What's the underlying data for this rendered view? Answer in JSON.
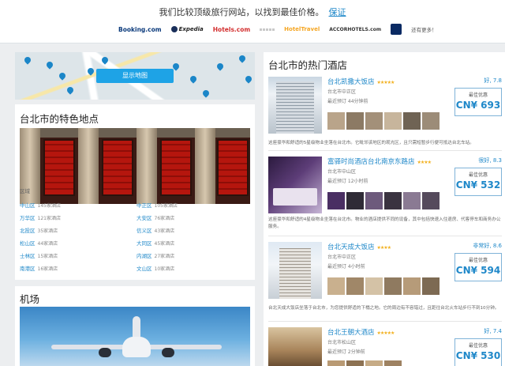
{
  "header": {
    "headline": "我们比较顶级旅行网站，以找到最佳价格。",
    "guarantee_link": "保证",
    "partners": {
      "booking": "Booking.com",
      "expedia": "Expedia",
      "hotels": "Hotels.com",
      "hoteltravel": "HotelTravel",
      "accor": "ACCORHOTELS.com",
      "more": "还有更多！"
    }
  },
  "map": {
    "button_label": "显示地图"
  },
  "places": {
    "title": "台北市的特色地点",
    "district_label": "区域",
    "districts": [
      {
        "name": "中山区",
        "count": "145家酒店"
      },
      {
        "name": "中正区",
        "count": "105家酒店"
      },
      {
        "name": "万华区",
        "count": "121家酒店"
      },
      {
        "name": "大安区",
        "count": "76家酒店"
      },
      {
        "name": "北投区",
        "count": "35家酒店"
      },
      {
        "name": "信义区",
        "count": "43家酒店"
      },
      {
        "name": "松山区",
        "count": "44家酒店"
      },
      {
        "name": "大同区",
        "count": "45家酒店"
      },
      {
        "name": "士林区",
        "count": "15家酒店"
      },
      {
        "name": "内湖区",
        "count": "27家酒店"
      },
      {
        "name": "南港区",
        "count": "16家酒店"
      },
      {
        "name": "文山区",
        "count": "10家酒店"
      }
    ]
  },
  "airport": {
    "title": "机场"
  },
  "hotels": {
    "title": "台北市的热门酒店",
    "price_label": "最佳优惠",
    "items": [
      {
        "name": "台北凯撒大饭店",
        "stars": "★★★★★",
        "district": "台北市中正区",
        "reviews": "最近预订  44分钟前",
        "rating": "好, 7.8",
        "price": "CN¥ 693",
        "description": "这座豪华和舒适的5星级物业坐落在台北市。它毗邻该地区的观光区，且只需短暂步行便可抵达台北车站。"
      },
      {
        "name": "富驿时尚酒店台北南京东路店",
        "stars": "★★★★",
        "district": "台北市中山区",
        "reviews": "最近预订  12小时前",
        "rating": "很好, 8.3",
        "price": "CN¥ 532",
        "description": "这座豪华和舒适的4星级物业坐落在台北市。物业的酒店提供不同的设备，其中包括快速入住退房、代客停车和商务办公服务。"
      },
      {
        "name": "台北天成大饭店",
        "stars": "★★★★",
        "district": "台北市中正区",
        "reviews": "最近预订  4小时前",
        "rating": "非常好, 8.6",
        "price": "CN¥ 594",
        "description": "台北天成大饭店坐落于台北市，为您提供舒适的下榻之地。它的周边有不容错过，且距往台北火车站步行不到10分钟。"
      },
      {
        "name": "台北王朝大酒店",
        "stars": "★★★★★",
        "district": "台北市松山区",
        "reviews": "最近预订  2分钟前",
        "rating": "好, 7.4",
        "price": "CN¥ 530",
        "description": ""
      }
    ]
  },
  "colors": {
    "accent": "#1f88c9",
    "map_button": "#1ea3e6",
    "star": "#f2b01e"
  }
}
